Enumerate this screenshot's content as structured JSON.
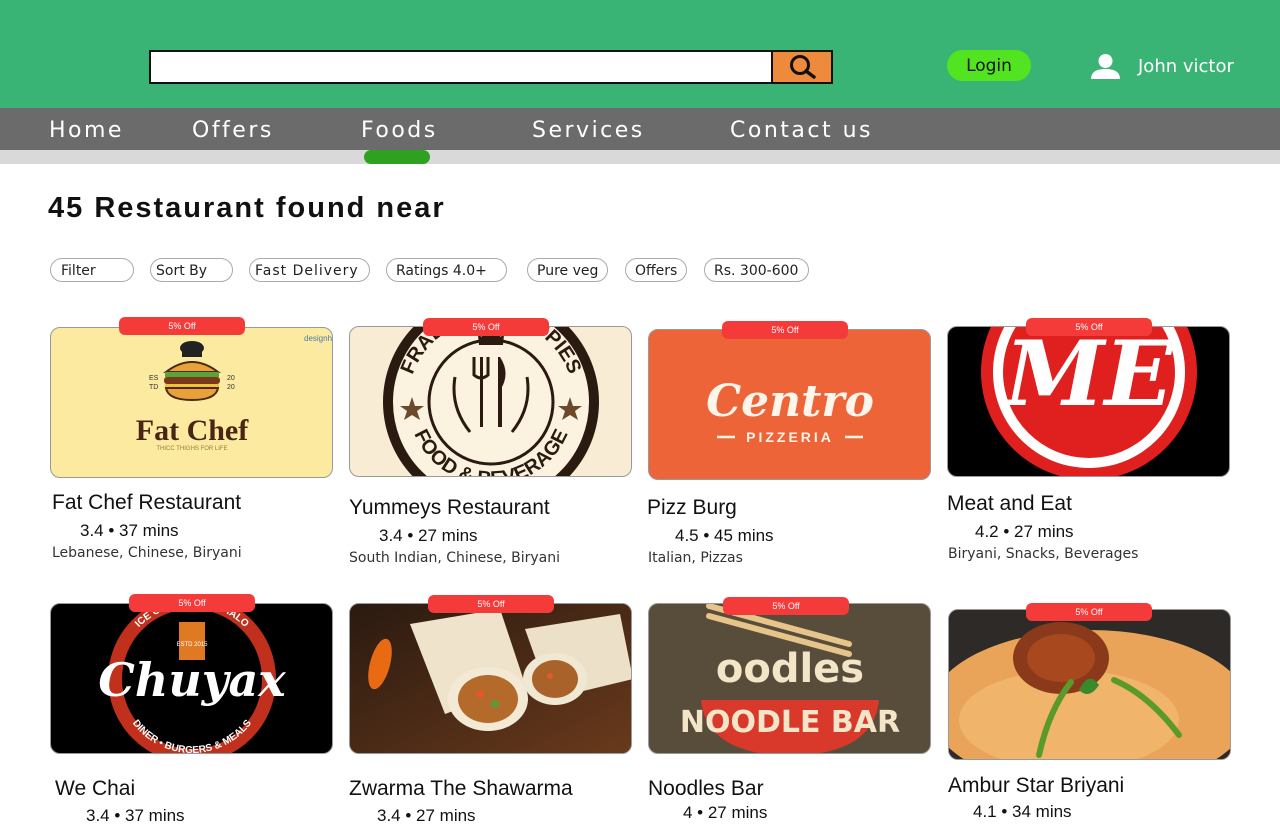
{
  "header": {
    "search": {
      "value": "",
      "placeholder": ""
    },
    "login_label": "Login",
    "user_name": "John victor"
  },
  "nav": {
    "items": [
      "Home",
      "Offers",
      "Foods",
      "Services",
      "Contact us"
    ],
    "active": "Foods"
  },
  "results": {
    "title": "45 Restaurant found near"
  },
  "filters": [
    "Filter",
    "Sort By",
    "Fast Delivery",
    "Ratings 4.0+",
    "Pure veg",
    "Offers",
    "Rs. 300-600"
  ],
  "restaurants": [
    {
      "name": "Fat Chef Restaurant",
      "meta": "3.4 • 37 mins",
      "cuisine": "Lebanese, Chinese, Biryani",
      "badge": "5% Off",
      "logo": {
        "title": "Fat Chef",
        "tagline": "THICC THIGHS FOR LIFE",
        "est_left": "ES TD",
        "est_right": "20 20",
        "watermark": "designhill"
      }
    },
    {
      "name": "Yummeys Restaurant",
      "meta": "3.4 • 27 mins",
      "cuisine": "South Indian, Chinese, Biryani",
      "badge": "5% Off",
      "logo": {
        "top": "FRADELL AND SPIES",
        "bottom": "FOOD & BEVERAGE"
      }
    },
    {
      "name": "Pizz Burg",
      "meta": "4.5 • 45 mins",
      "cuisine": "Italian, Pizzas",
      "badge": "5% Off",
      "logo": {
        "title": "Centro",
        "subtitle": "PIZZERIA"
      }
    },
    {
      "name": "Meat and Eat",
      "meta": "4.2 • 27 mins",
      "cuisine": "Biryani, Snacks, Beverages",
      "badge": "5% Off",
      "logo": {
        "title": "ME"
      }
    },
    {
      "name": "We Chai",
      "meta": "3.4 • 37 mins",
      "cuisine": "",
      "badge": "5% Off",
      "logo": {
        "title": "Chuyax",
        "arc_top": "ICE CREAM HALO HALO",
        "arc_bottom": "DINER • BURGERS & MEALS",
        "est": "ESTD 2015"
      }
    },
    {
      "name": "Zwarma The Shawarma",
      "meta": "3.4 • 27 mins",
      "cuisine": "",
      "badge": "5% Off",
      "logo": {}
    },
    {
      "name": "Noodles Bar",
      "meta": "4 • 27 mins",
      "cuisine": "",
      "badge": "5% Off",
      "logo": {
        "title": "oodles",
        "subtitle": "NOODLE BAR"
      }
    },
    {
      "name": "Ambur Star Briyani",
      "meta": "4.1 • 34 mins",
      "cuisine": "",
      "badge": "5% Off",
      "logo": {}
    }
  ],
  "colors": {
    "header_bg": "#3ab475",
    "nav_bg": "#6b6b6b",
    "nav_indicator": "#2fa121",
    "login_bg": "#53e421",
    "search_button": "#ee8a3c",
    "badge": "#f53a3a"
  },
  "icons": {
    "search": "magnifier-icon",
    "user": "user-icon"
  }
}
